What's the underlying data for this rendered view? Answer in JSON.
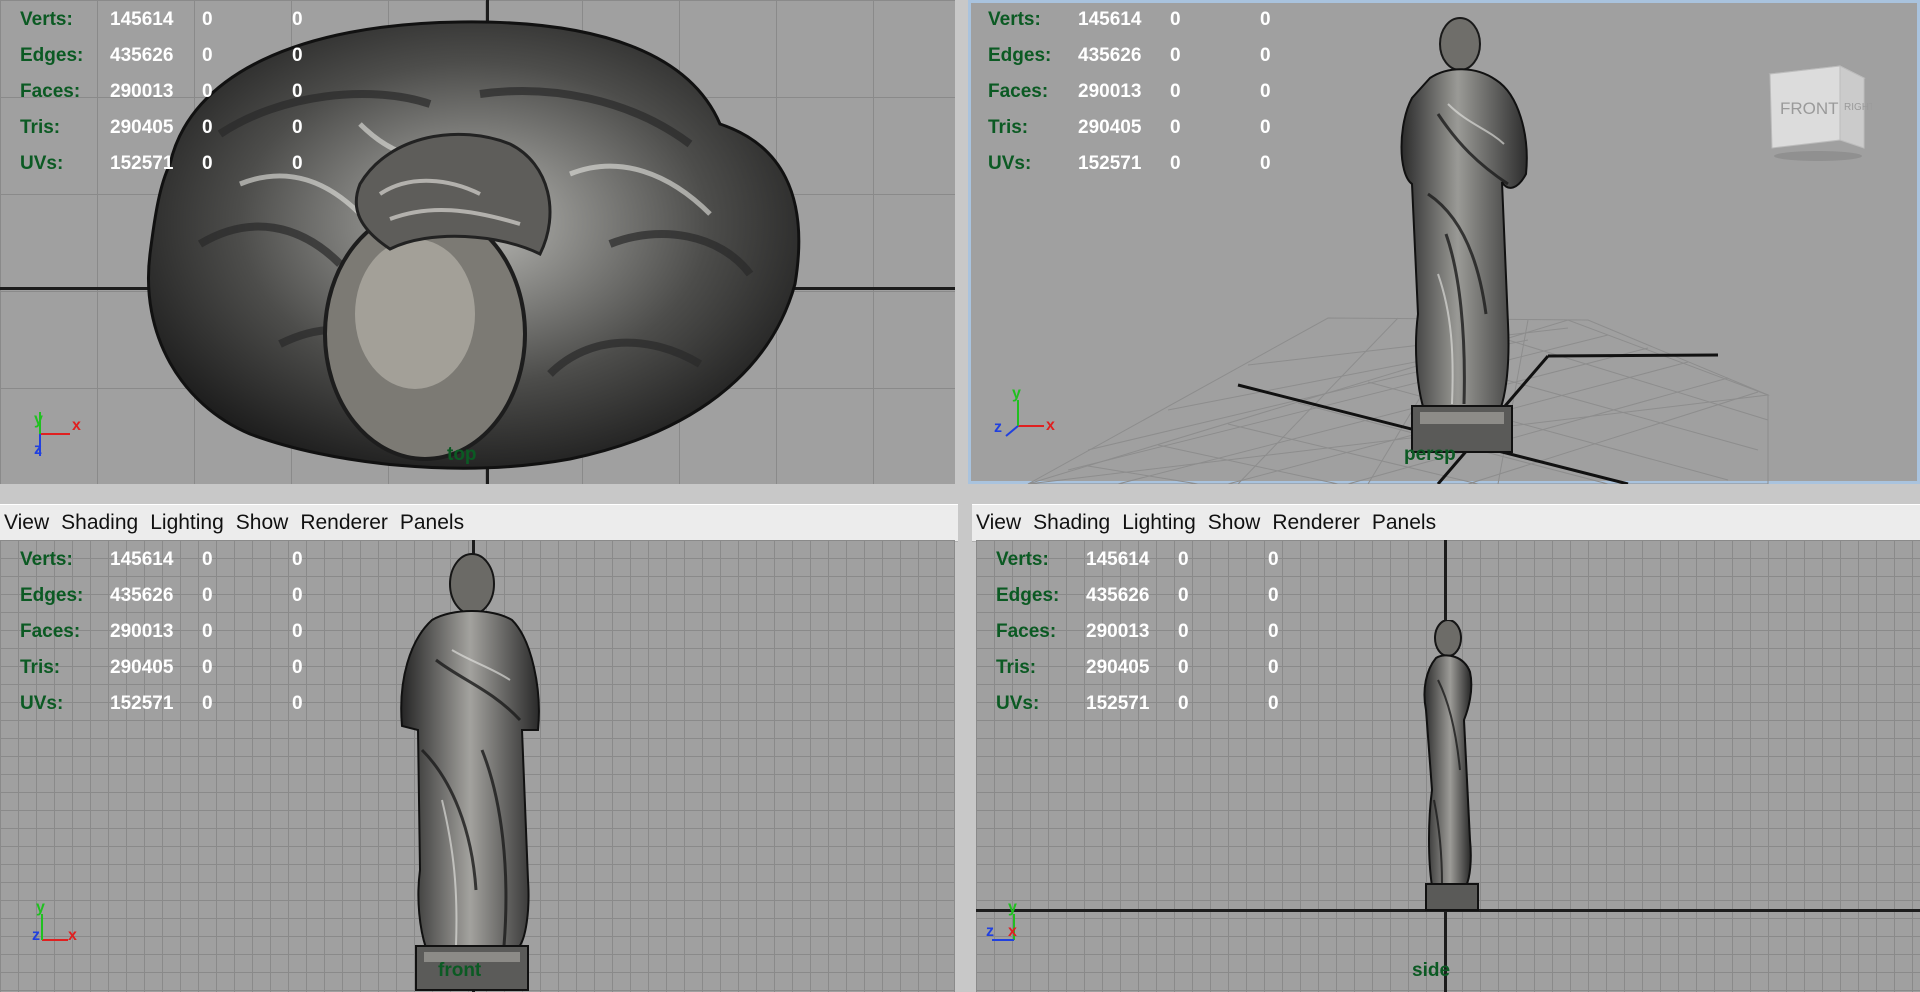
{
  "menu": [
    "View",
    "Shading",
    "Lighting",
    "Show",
    "Renderer",
    "Panels"
  ],
  "hud": [
    {
      "label": "Verts:",
      "v1": "145614",
      "v2": "0",
      "v3": "0"
    },
    {
      "label": "Edges:",
      "v1": "435626",
      "v2": "0",
      "v3": "0"
    },
    {
      "label": "Faces:",
      "v1": "290013",
      "v2": "0",
      "v3": "0"
    },
    {
      "label": "Tris:",
      "v1": "290405",
      "v2": "0",
      "v3": "0"
    },
    {
      "label": "UVs:",
      "v1": "152571",
      "v2": "0",
      "v3": "0"
    }
  ],
  "cameras": {
    "top": "top",
    "persp": "persp",
    "front": "front",
    "side": "side"
  },
  "viewcube": {
    "front": "FRONT",
    "right": "RIGHT"
  },
  "axes": {
    "x": "x",
    "y": "y",
    "z": "z"
  },
  "colors": {
    "viewport_bg": "#a0a0a0",
    "hud_label": "#0b5a23",
    "hud_value": "#ffffff",
    "axis_x": "#e02020",
    "axis_y": "#20c020",
    "axis_z": "#2040e0",
    "active_border": "#a9c3de"
  }
}
